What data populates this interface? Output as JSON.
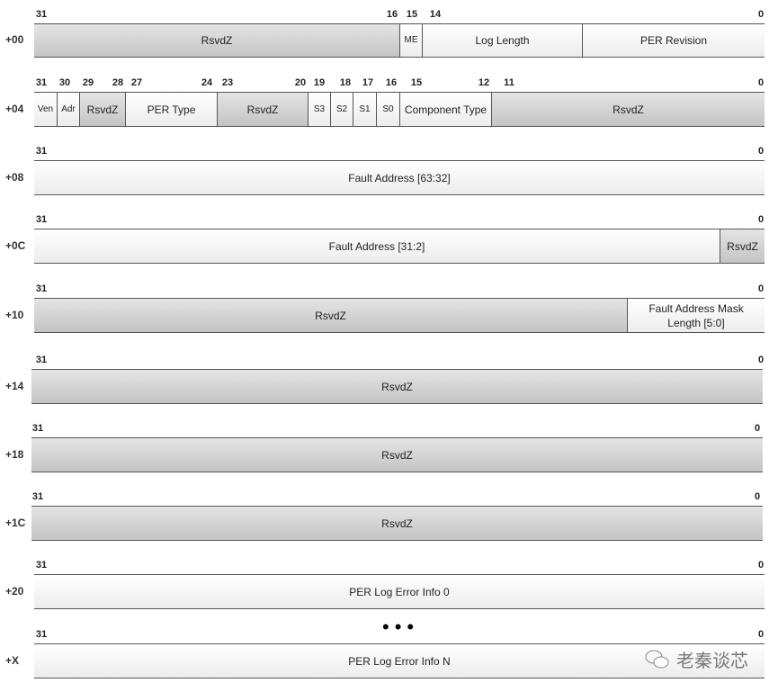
{
  "rows": [
    {
      "offset": "+00",
      "bits": [
        "31",
        "16",
        "15",
        "14",
        "0"
      ],
      "cells": [
        {
          "label": "RsvdZ",
          "reserved": true
        },
        {
          "label": "ME",
          "reserved": false
        },
        {
          "label": "Log Length",
          "reserved": false
        },
        {
          "label": "PER Revision",
          "reserved": false
        }
      ]
    },
    {
      "offset": "+04",
      "bits": [
        "31",
        "30",
        "29",
        "28",
        "27",
        "24",
        "23",
        "20",
        "19",
        "18",
        "17",
        "16",
        "15",
        "12",
        "11",
        "0"
      ],
      "cells": [
        {
          "label": "Ven",
          "reserved": false
        },
        {
          "label": "Adr",
          "reserved": false
        },
        {
          "label": "RsvdZ",
          "reserved": true
        },
        {
          "label": "PER Type",
          "reserved": false
        },
        {
          "label": "RsvdZ",
          "reserved": true
        },
        {
          "label": "S3",
          "reserved": false
        },
        {
          "label": "S2",
          "reserved": false
        },
        {
          "label": "S1",
          "reserved": false
        },
        {
          "label": "S0",
          "reserved": false
        },
        {
          "label": "Component Type",
          "reserved": false
        },
        {
          "label": "RsvdZ",
          "reserved": true
        }
      ]
    },
    {
      "offset": "+08",
      "bits": [
        "31",
        "0"
      ],
      "cells": [
        {
          "label": "Fault Address [63:32]",
          "reserved": false
        }
      ]
    },
    {
      "offset": "+0C",
      "bits": [
        "31",
        "0"
      ],
      "cells": [
        {
          "label": "Fault Address [31:2]",
          "reserved": false
        },
        {
          "label": "RsvdZ",
          "reserved": true
        }
      ]
    },
    {
      "offset": "+10",
      "bits": [
        "31",
        "0"
      ],
      "cells": [
        {
          "label": "RsvdZ",
          "reserved": true
        },
        {
          "label": "Fault Address Mask Length [5:0]",
          "reserved": false
        }
      ]
    },
    {
      "offset": "+14",
      "bits": [
        "31",
        "0"
      ],
      "cells": [
        {
          "label": "RsvdZ",
          "reserved": true
        }
      ]
    },
    {
      "offset": "+18",
      "bits": [
        "31",
        "0"
      ],
      "cells": [
        {
          "label": "RsvdZ",
          "reserved": true
        }
      ]
    },
    {
      "offset": "+1C",
      "bits": [
        "31",
        "0"
      ],
      "cells": [
        {
          "label": "RsvdZ",
          "reserved": true
        }
      ]
    },
    {
      "offset": "+20",
      "bits": [
        "31",
        "0"
      ],
      "cells": [
        {
          "label": "PER Log Error Info 0",
          "reserved": false
        }
      ]
    },
    {
      "offset": "+X",
      "bits": [
        "31",
        "0"
      ],
      "cells": [
        {
          "label": "PER Log Error Info N",
          "reserved": false
        }
      ]
    }
  ],
  "ellipsis": "•••",
  "watermark": "老秦谈芯"
}
